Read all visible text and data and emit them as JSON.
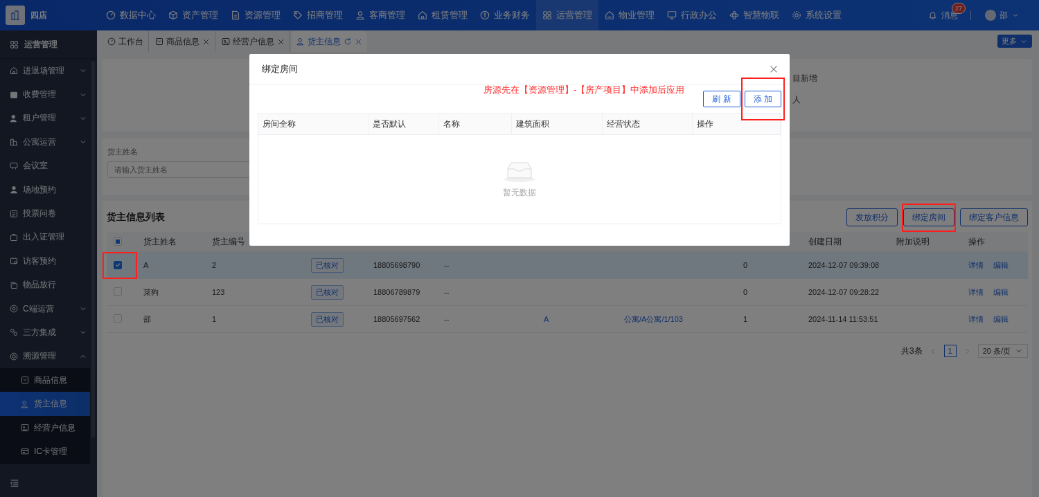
{
  "app": {
    "store_name": "四店"
  },
  "top_nav": [
    {
      "label": "数据中心",
      "selected": false
    },
    {
      "label": "资产管理",
      "selected": false
    },
    {
      "label": "资源管理",
      "selected": false
    },
    {
      "label": "招商管理",
      "selected": false
    },
    {
      "label": "客商管理",
      "selected": false
    },
    {
      "label": "租赁管理",
      "selected": false
    },
    {
      "label": "业务财务",
      "selected": false
    },
    {
      "label": "运营管理",
      "selected": true
    },
    {
      "label": "物业管理",
      "selected": false
    },
    {
      "label": "行政办公",
      "selected": false
    },
    {
      "label": "智慧物联",
      "selected": false
    },
    {
      "label": "系统设置",
      "selected": false
    }
  ],
  "notifications": {
    "label": "消息",
    "badge": "27"
  },
  "user": {
    "name": "邵"
  },
  "sidebar": {
    "title": "运营管理",
    "items": [
      {
        "label": "进退场管理",
        "kind": "group",
        "expanded": false
      },
      {
        "label": "收费管理",
        "kind": "group",
        "expanded": false
      },
      {
        "label": "租户管理",
        "kind": "group",
        "expanded": false
      },
      {
        "label": "公寓运营",
        "kind": "group",
        "expanded": false
      },
      {
        "label": "会议室",
        "kind": "leaf"
      },
      {
        "label": "场地预约",
        "kind": "leaf"
      },
      {
        "label": "投票问卷",
        "kind": "leaf"
      },
      {
        "label": "出入证管理",
        "kind": "leaf"
      },
      {
        "label": "访客预约",
        "kind": "leaf"
      },
      {
        "label": "物品放行",
        "kind": "leaf"
      },
      {
        "label": "C端运营",
        "kind": "group",
        "expanded": false
      },
      {
        "label": "三方集成",
        "kind": "group",
        "expanded": false
      },
      {
        "label": "溯源管理",
        "kind": "group",
        "expanded": true,
        "children": [
          {
            "label": "商品信息",
            "selected": false
          },
          {
            "label": "货主信息",
            "selected": true
          },
          {
            "label": "经营户信息",
            "selected": false
          },
          {
            "label": "IC卡管理",
            "selected": false
          }
        ]
      }
    ]
  },
  "tabs": [
    {
      "label": "工作台",
      "closable": false,
      "selected": false
    },
    {
      "label": "商品信息",
      "closable": true,
      "selected": false
    },
    {
      "label": "经营户信息",
      "closable": true,
      "selected": false
    },
    {
      "label": "货主信息",
      "closable": true,
      "selected": true
    }
  ],
  "more_button": "更多",
  "summary_card": {
    "texts": [
      "目新增",
      "人"
    ]
  },
  "search": {
    "label": "货主姓名",
    "placeholder": "请输入货主姓名"
  },
  "list": {
    "title": "货主信息列表",
    "buttons": [
      {
        "label": "发放积分",
        "highlighted": false
      },
      {
        "label": "绑定房间",
        "highlighted": true
      },
      {
        "label": "绑定客户信息",
        "highlighted": false
      }
    ],
    "select_all": {
      "indeterminate": true
    },
    "columns_left": [
      "货主姓名",
      "货主编号"
    ],
    "columns_right": [
      "创建日期",
      "附加说明",
      "操作"
    ],
    "rows": [
      {
        "checked": true,
        "highlighted": true,
        "name": "A",
        "code": "2",
        "status": "已核对",
        "phone": "18805698790",
        "column_5": "--",
        "column_8": "0",
        "created": "2024-12-07 09:39:08",
        "actions": [
          "详情",
          "编辑"
        ]
      },
      {
        "checked": false,
        "highlighted": false,
        "name": "菜狗",
        "code": "123",
        "status": "已核对",
        "phone": "18806789879",
        "column_5": "--",
        "column_8": "0",
        "created": "2024-12-07 09:28:22",
        "actions": [
          "详情",
          "编辑"
        ]
      },
      {
        "checked": false,
        "highlighted": false,
        "name": "邵",
        "code": "1",
        "status": "已核对",
        "phone": "18805697562",
        "column_5": "--",
        "column_6": "A",
        "column_7": "公寓/A公寓/1/103",
        "column_8": "1",
        "created": "2024-11-14 11:53:51",
        "actions": [
          "详情",
          "编辑"
        ]
      }
    ]
  },
  "pagination": {
    "total": "共3条",
    "pages": [
      {
        "label": "1",
        "selected": true
      }
    ],
    "page_size": "20 条/页"
  },
  "modal": {
    "title": "绑定房间",
    "note": "房源先在【资源管理】-【房产项目】中添加后应用",
    "buttons": [
      {
        "label": "刷 新",
        "highlighted": false
      },
      {
        "label": "添 加",
        "highlighted": true
      }
    ],
    "columns": [
      "房间全称",
      "是否默认",
      "名称",
      "建筑面积",
      "经营状态",
      "操作"
    ],
    "empty_text": "暂无数据"
  }
}
